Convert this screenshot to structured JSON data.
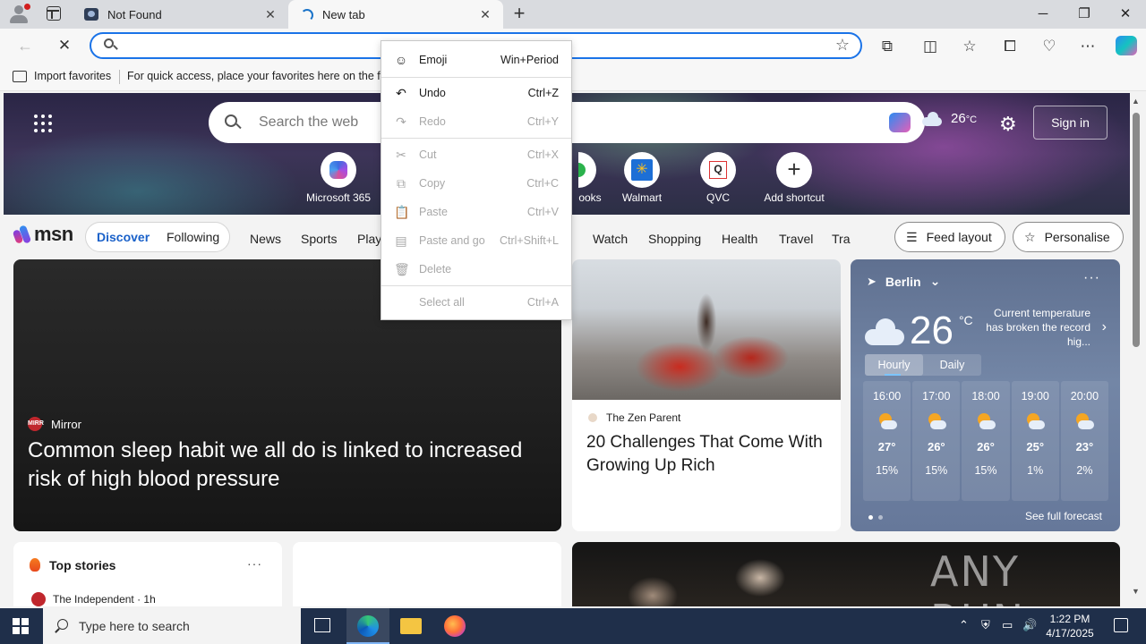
{
  "tabs": [
    {
      "title": "Not Found",
      "icon": "page-icon"
    },
    {
      "title": "New tab",
      "icon": "loading-icon"
    }
  ],
  "address_bar": {
    "value": "",
    "placeholder": ""
  },
  "favorites_bar": {
    "import_label": "Import favorites",
    "hint": "For quick access, place your favorites here on the favo"
  },
  "msn_header": {
    "search_placeholder": "Search the web",
    "weather_temp": "26",
    "weather_unit": "°C",
    "sign_in": "Sign in"
  },
  "shortcuts": [
    {
      "label": "Microsoft 365",
      "icon": "microsoft365-icon"
    },
    {
      "label": "ooks",
      "icon": "books-icon"
    },
    {
      "label": "Walmart",
      "icon": "walmart-icon"
    },
    {
      "label": "QVC",
      "icon": "qvc-icon"
    },
    {
      "label": "Add shortcut",
      "icon": "plus-icon"
    }
  ],
  "msn_nav": {
    "logo": "msn",
    "discover": "Discover",
    "following": "Following",
    "items": [
      "News",
      "Sports",
      "Play",
      "Watch",
      "Shopping",
      "Health",
      "Travel",
      "Tra"
    ],
    "feed_layout": "Feed layout",
    "personalise": "Personalise"
  },
  "main_story": {
    "source": "Mirror",
    "source_logo": "MIRR",
    "headline": "Common sleep habit we all do is linked to increased risk of high blood pressure"
  },
  "zen_story": {
    "source": "The Zen Parent",
    "headline": "20 Challenges That Come With Growing Up Rich"
  },
  "weather": {
    "city": "Berlin",
    "temp": "26",
    "unit": "°C",
    "note": "Current temperature has broken the record hig...",
    "tab_hourly": "Hourly",
    "tab_daily": "Daily",
    "hours": [
      {
        "time": "16:00",
        "temp": "27°",
        "precip": "15%"
      },
      {
        "time": "17:00",
        "temp": "26°",
        "precip": "15%"
      },
      {
        "time": "18:00",
        "temp": "26°",
        "precip": "15%"
      },
      {
        "time": "19:00",
        "temp": "25°",
        "precip": "1%"
      },
      {
        "time": "20:00",
        "temp": "23°",
        "precip": "2%"
      }
    ],
    "forecast_link": "See full forecast"
  },
  "top_stories": {
    "title": "Top stories",
    "first_source": "The Independent · 1h"
  },
  "watermark": "ANY RUN",
  "context_menu": {
    "items": [
      {
        "label": "Emoji",
        "shortcut": "Win+Period",
        "icon": "emoji-icon",
        "enabled": true
      },
      {
        "label": "Undo",
        "shortcut": "Ctrl+Z",
        "icon": "undo-icon",
        "enabled": true
      },
      {
        "label": "Redo",
        "shortcut": "Ctrl+Y",
        "icon": "redo-icon",
        "enabled": false
      },
      {
        "label": "Cut",
        "shortcut": "Ctrl+X",
        "icon": "cut-icon",
        "enabled": false
      },
      {
        "label": "Copy",
        "shortcut": "Ctrl+C",
        "icon": "copy-icon",
        "enabled": false
      },
      {
        "label": "Paste",
        "shortcut": "Ctrl+V",
        "icon": "paste-icon",
        "enabled": false
      },
      {
        "label": "Paste and go",
        "shortcut": "Ctrl+Shift+L",
        "icon": "paste-go-icon",
        "enabled": false
      },
      {
        "label": "Delete",
        "shortcut": "",
        "icon": "delete-icon",
        "enabled": false
      },
      {
        "label": "Select all",
        "shortcut": "Ctrl+A",
        "icon": "",
        "enabled": false
      }
    ]
  },
  "taskbar": {
    "search_placeholder": "Type here to search",
    "time": "1:22 PM",
    "date": "4/17/2025"
  }
}
